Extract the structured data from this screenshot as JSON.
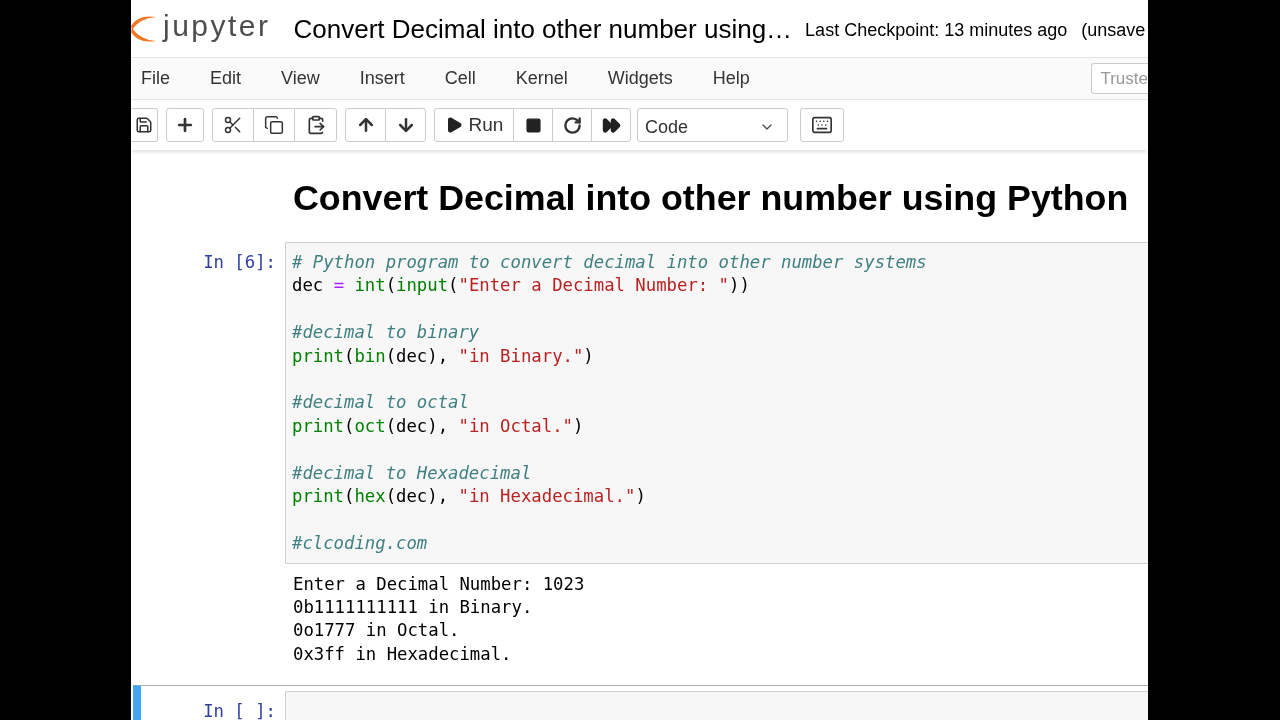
{
  "header": {
    "logo_text": "jupyter",
    "notebook_title": "Convert Decimal into other number using…",
    "checkpoint": "Last Checkpoint: 13 minutes ago",
    "save_status": "(unsave"
  },
  "menubar": {
    "items": [
      "File",
      "Edit",
      "View",
      "Insert",
      "Cell",
      "Kernel",
      "Widgets",
      "Help"
    ],
    "trusted_label": "Truste"
  },
  "toolbar": {
    "run_label": "Run",
    "cell_type": "Code"
  },
  "cells": [
    {
      "kind": "markdown",
      "selected": false,
      "heading": "Convert Decimal into other number using Python"
    },
    {
      "kind": "code",
      "selected": false,
      "prompt": "In [6]:",
      "blocks": [
        [
          [
            {
              "kind": "comment",
              "text": "# Python program to convert decimal into other number systems"
            }
          ],
          [
            {
              "kind": "plain",
              "text": "dec "
            },
            {
              "kind": "operator",
              "text": "= "
            },
            {
              "kind": "builtin",
              "text": "int"
            },
            {
              "kind": "plain",
              "text": "("
            },
            {
              "kind": "builtin",
              "text": "input"
            },
            {
              "kind": "plain",
              "text": "("
            },
            {
              "kind": "string",
              "text": "\"Enter a Decimal Number: \""
            },
            {
              "kind": "plain",
              "text": "))"
            }
          ]
        ],
        [
          [
            {
              "kind": "comment",
              "text": "#decimal to binary"
            }
          ],
          [
            {
              "kind": "builtin",
              "text": "print"
            },
            {
              "kind": "plain",
              "text": "("
            },
            {
              "kind": "builtin",
              "text": "bin"
            },
            {
              "kind": "plain",
              "text": "(dec), "
            },
            {
              "kind": "string",
              "text": "\"in Binary.\""
            },
            {
              "kind": "plain",
              "text": ")"
            }
          ]
        ],
        [
          [
            {
              "kind": "comment",
              "text": "#decimal to octal"
            }
          ],
          [
            {
              "kind": "builtin",
              "text": "print"
            },
            {
              "kind": "plain",
              "text": "("
            },
            {
              "kind": "builtin",
              "text": "oct"
            },
            {
              "kind": "plain",
              "text": "(dec), "
            },
            {
              "kind": "string",
              "text": "\"in Octal.\""
            },
            {
              "kind": "plain",
              "text": ")"
            }
          ]
        ],
        [
          [
            {
              "kind": "comment",
              "text": "#decimal to Hexadecimal"
            }
          ],
          [
            {
              "kind": "builtin",
              "text": "print"
            },
            {
              "kind": "plain",
              "text": "("
            },
            {
              "kind": "builtin",
              "text": "hex"
            },
            {
              "kind": "plain",
              "text": "(dec), "
            },
            {
              "kind": "string",
              "text": "\"in Hexadecimal.\""
            },
            {
              "kind": "plain",
              "text": ")"
            }
          ]
        ],
        [
          [
            {
              "kind": "comment",
              "text": "#clcoding.com"
            }
          ]
        ]
      ],
      "output": [
        "Enter a Decimal Number: 1023",
        "0b1111111111 in Binary.",
        "0o1777 in Octal.",
        "0x3ff in Hexadecimal."
      ]
    },
    {
      "kind": "code",
      "selected": true,
      "prompt": "In [ ]:"
    }
  ]
}
